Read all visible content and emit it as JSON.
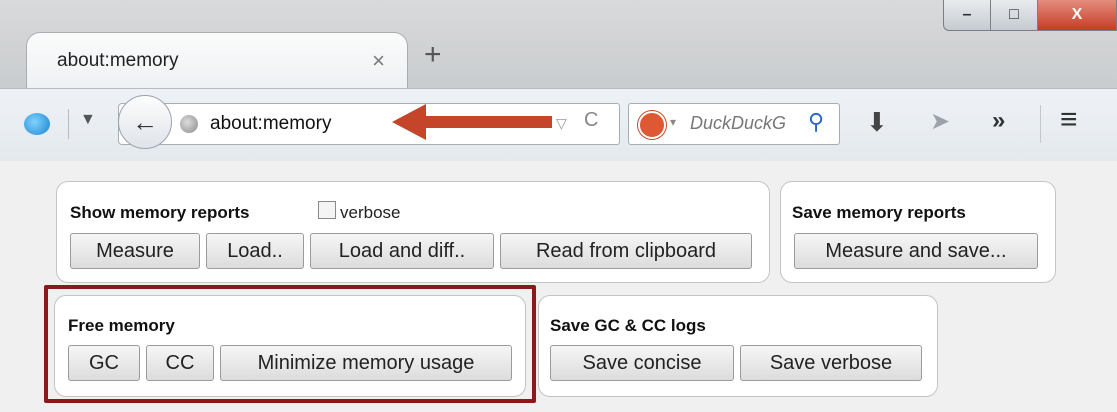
{
  "window": {
    "minimize_glyph": "–",
    "maximize_glyph": "□",
    "close_glyph": "X"
  },
  "tab": {
    "title": "about:memory",
    "close_glyph": "×",
    "newtab_glyph": "+"
  },
  "navbar": {
    "back_glyph": "←",
    "dropdown_glyph": "▼",
    "url": "about:memory",
    "urlbar_dropdown_glyph": "▽",
    "reload_glyph": "C",
    "search_engine_dropdown_glyph": "▾",
    "search_placeholder": "DuckDuckG",
    "search_glyph": "⚲",
    "download_glyph": "⬇",
    "share_glyph": "➤",
    "overflow_glyph": "»",
    "menu_glyph": "≡",
    "annotation_arrow_color": "#c5452a"
  },
  "show_reports": {
    "title": "Show memory reports",
    "verbose_label": "verbose",
    "buttons": [
      "Measure",
      "Load..",
      "Load and diff..",
      "Read from clipboard"
    ]
  },
  "save_reports": {
    "title": "Save memory reports",
    "button": "Measure and save..."
  },
  "free_memory": {
    "title": "Free memory",
    "buttons": [
      "GC",
      "CC",
      "Minimize memory usage"
    ],
    "highlight_color": "#8a1a1a"
  },
  "save_logs": {
    "title": "Save GC & CC logs",
    "buttons": [
      "Save concise",
      "Save verbose"
    ]
  }
}
